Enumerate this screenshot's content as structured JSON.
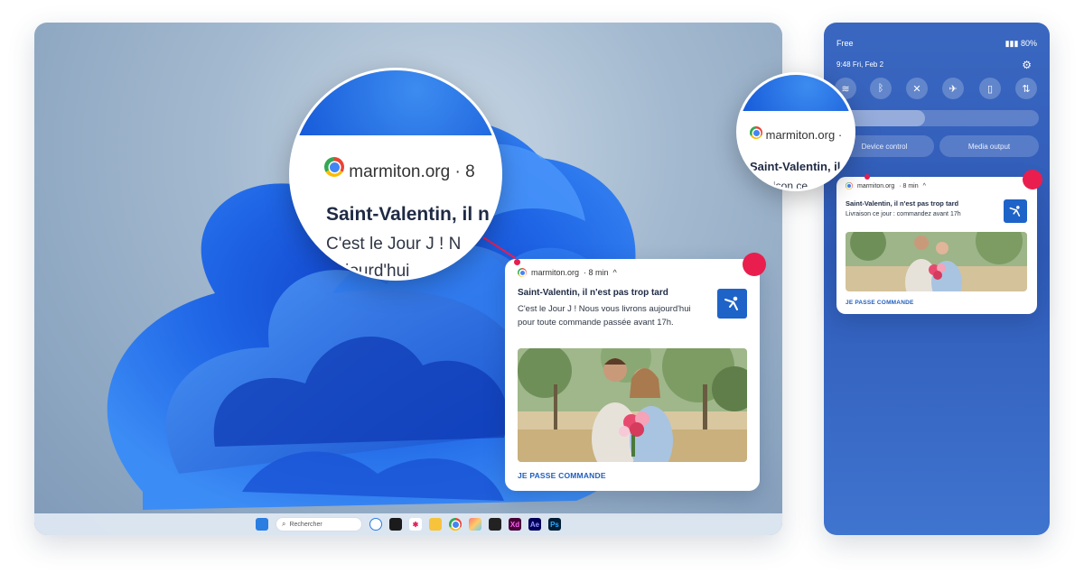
{
  "colors": {
    "accent": "#1f5fbf",
    "dot": "#e91e4f",
    "windows_blue": "#1558d8"
  },
  "desktop": {
    "taskbar": {
      "search_placeholder": "Rechercher",
      "apps": [
        "windows-icon",
        "copilot-icon",
        "app-icon",
        "app-icon",
        "explorer-icon",
        "chrome-icon",
        "app-icon",
        "app-icon",
        "xd-icon",
        "ae-icon",
        "ps-icon"
      ],
      "labels": {
        "xd": "Xd",
        "ae": "Ae",
        "ps": "Ps"
      }
    },
    "notification": {
      "source": "marmiton.org",
      "time": "· 8 min",
      "chevron": "^",
      "title": "Saint-Valentin, il n'est pas trop tard",
      "body": "C'est le Jour J ! Nous vous livrons aujourd'hui pour toute commande passée avant 17h.",
      "action": "JE PASSE COMMANDE"
    },
    "magnifier": {
      "source": "marmiton.org",
      "time": "· 8",
      "title": "Saint-Valentin, il n",
      "body1": "C'est le Jour J ! N",
      "body2": "aujourd'hui"
    }
  },
  "phone": {
    "carrier": "Free",
    "battery": "80%",
    "clock": "9:48",
    "date": "Fri, Feb 2",
    "device_control": "Device control",
    "media_output": "Media output",
    "notification": {
      "source": "marmiton.org",
      "time": "· 8 min",
      "chevron": "^",
      "title": "Saint-Valentin, il n'est pas trop tard",
      "body": "Livraison ce jour : commandez avant 17h",
      "action": "JE PASSE COMMANDE"
    },
    "magnifier": {
      "source": "marmiton.org",
      "time": "·",
      "title": "Saint-Valentin, il",
      "body": "Livraison ce"
    }
  }
}
